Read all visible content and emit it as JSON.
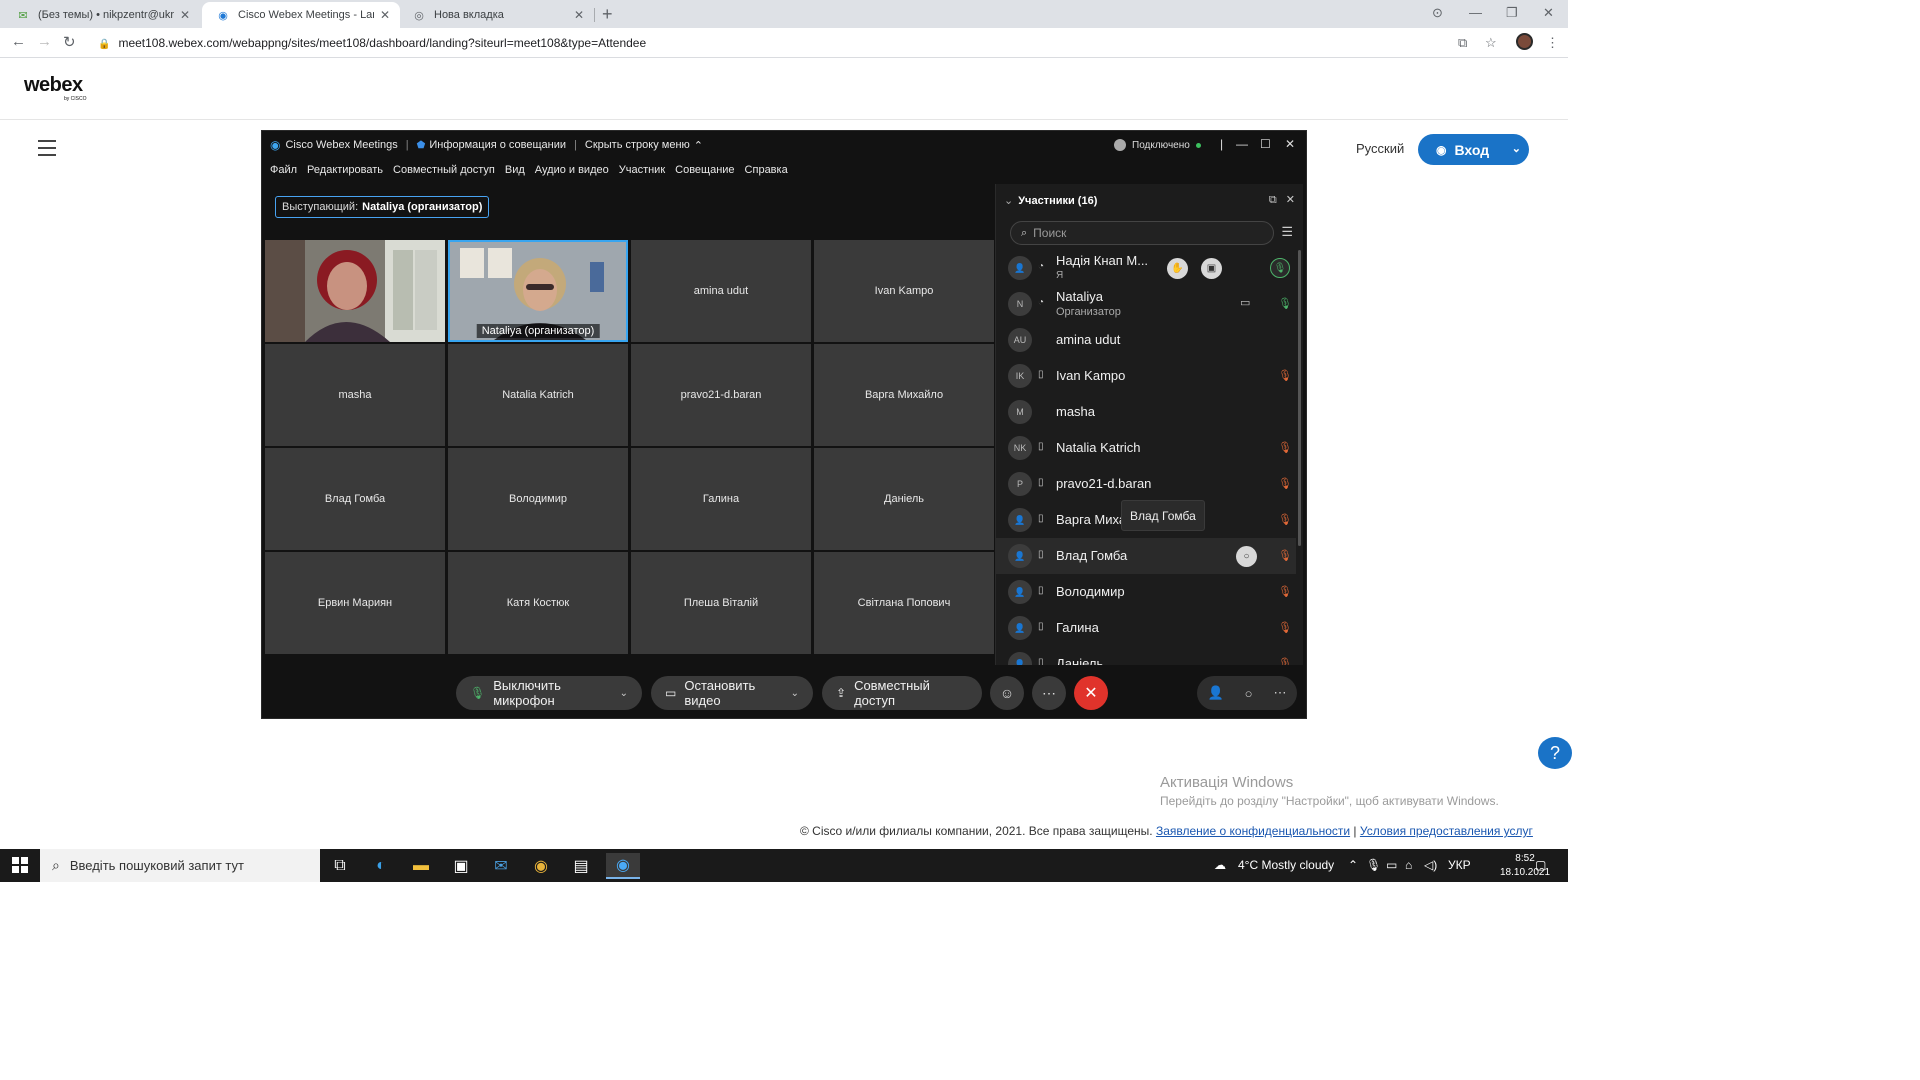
{
  "browser": {
    "tabs": [
      {
        "title": "(Без темы) • nikpzentr@ukr.net",
        "icon": "mail-icon"
      },
      {
        "title": "Cisco Webex Meetings - Landing",
        "icon": "webex-icon"
      },
      {
        "title": "Нова вкладка",
        "icon": "chrome-icon"
      }
    ],
    "url": "meet108.webex.com/webappng/sites/meet108/dashboard/landing?siteurl=meet108&type=Attendee"
  },
  "site": {
    "logo": "webex",
    "logo_sub": "by CISCO",
    "language": "Русский",
    "login_label": "Вход",
    "help": "?",
    "activation_title": "Активація Windows",
    "activation_sub": "Перейдіть до розділу \"Настройки\", щоб активувати Windows.",
    "footer_text": "© Cisco и/или филиалы компании, 2021. Все права защищены.",
    "footer_privacy": "Заявление о конфиденциальности",
    "footer_sep": "|",
    "footer_terms": "Условия предоставления услуг"
  },
  "meeting": {
    "app_title": "Cisco Webex Meetings",
    "info": "Информация о совещании",
    "hide_menu": "Скрыть строку меню",
    "status": "Подключено",
    "menu": [
      "Файл",
      "Редактировать",
      "Совместный доступ",
      "Вид",
      "Аудио и видео",
      "Участник",
      "Совещание",
      "Справка"
    ],
    "speaker_prefix": "Выступающий:",
    "speaker_name": "Nataliya (организатор)",
    "tiles": [
      {
        "name": "",
        "type": "video-woman-red"
      },
      {
        "name": "Nataliya  (организатор)",
        "type": "video-woman-blonde"
      },
      {
        "name": "amina udut"
      },
      {
        "name": "Ivan Kampo"
      },
      {
        "name": "masha"
      },
      {
        "name": "Natalia Katrich"
      },
      {
        "name": "pravo21-d.baran"
      },
      {
        "name": "Варга Михайло"
      },
      {
        "name": "Влад Гомба"
      },
      {
        "name": "Володимир"
      },
      {
        "name": "Галина"
      },
      {
        "name": "Даніель"
      },
      {
        "name": "Ервин Мариян"
      },
      {
        "name": "Катя Костюк"
      },
      {
        "name": "Плеша Віталій"
      },
      {
        "name": "Світлана Попович"
      }
    ],
    "controls": {
      "mute": "Выключить микрофон",
      "video": "Остановить видео",
      "share": "Совместный доступ"
    },
    "participants": {
      "header": "Участники (16)",
      "search_placeholder": "Поиск",
      "tooltip": "Влад Гомба",
      "rows": [
        {
          "initials": "",
          "name": "Надія Кнап М...",
          "sub": "Я"
        },
        {
          "initials": "N",
          "name": "Nataliya",
          "sub": "Организатор"
        },
        {
          "initials": "AU",
          "name": "amina udut",
          "sub": ""
        },
        {
          "initials": "IK",
          "name": "Ivan Kampo",
          "sub": ""
        },
        {
          "initials": "M",
          "name": "masha",
          "sub": ""
        },
        {
          "initials": "NK",
          "name": "Natalia Katrich",
          "sub": ""
        },
        {
          "initials": "P",
          "name": "pravo21-d.baran",
          "sub": ""
        },
        {
          "initials": "",
          "name": "Варга Миха",
          "sub": ""
        },
        {
          "initials": "",
          "name": "Влад Гомба",
          "sub": ""
        },
        {
          "initials": "",
          "name": "Володимир",
          "sub": ""
        },
        {
          "initials": "",
          "name": "Галина",
          "sub": ""
        },
        {
          "initials": "",
          "name": "Даніель",
          "sub": ""
        }
      ]
    }
  },
  "taskbar": {
    "search": "Введіть пошуковий запит тут",
    "weather": "4°C  Mostly cloudy",
    "lang": "УКР",
    "time": "8:52",
    "date": "18.10.2021"
  }
}
